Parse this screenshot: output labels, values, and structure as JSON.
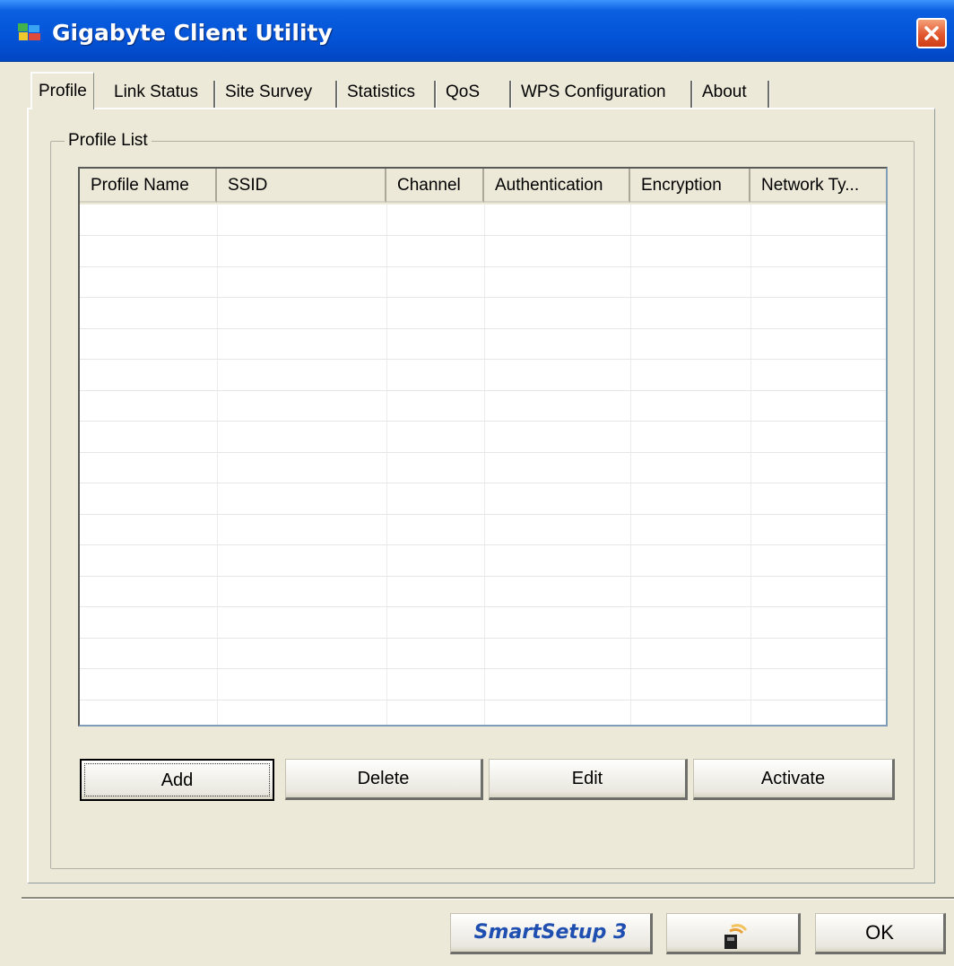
{
  "window": {
    "title": "Gigabyte Client Utility",
    "accent": "#0454d8",
    "close_color": "#e2582f"
  },
  "tabs": [
    {
      "label": "Profile",
      "active": true
    },
    {
      "label": "Link Status",
      "active": false
    },
    {
      "label": "Site Survey",
      "active": false
    },
    {
      "label": "Statistics",
      "active": false
    },
    {
      "label": "QoS",
      "active": false
    },
    {
      "label": "WPS Configuration",
      "active": false
    },
    {
      "label": "About",
      "active": false
    }
  ],
  "profile_list": {
    "group_label": "Profile List",
    "columns": [
      "Profile Name",
      "SSID",
      "Channel",
      "Authentication",
      "Encryption",
      "Network Ty..."
    ],
    "rows": []
  },
  "actions": {
    "add": "Add",
    "delete": "Delete",
    "edit": "Edit",
    "activate": "Activate"
  },
  "footer": {
    "smartsetup": "SmartSetup 3",
    "ok": "OK"
  },
  "icons": {
    "app": "gigabyte-logo-icon",
    "close": "close-icon",
    "wps": "wireless-card-icon"
  }
}
